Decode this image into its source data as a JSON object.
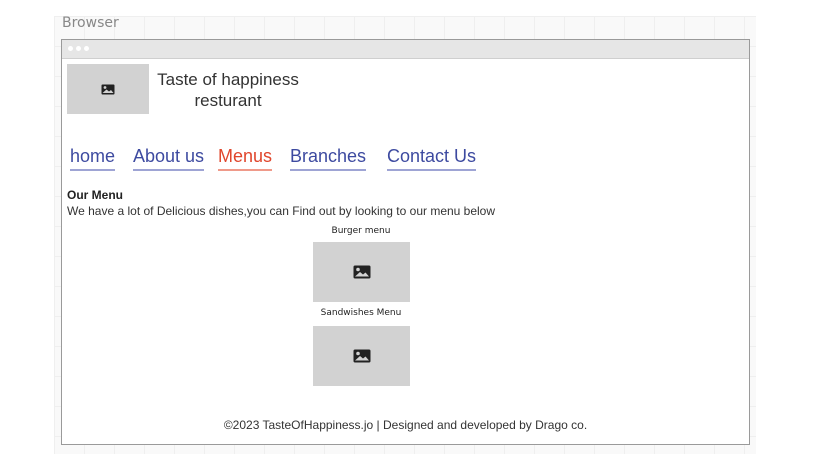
{
  "canvas_label": "Browser",
  "site": {
    "logo_icon": "image-icon",
    "title_line1": "Taste of happiness",
    "title_line2": "resturant"
  },
  "nav": [
    {
      "label": "home",
      "active": false
    },
    {
      "label": "About us",
      "active": false
    },
    {
      "label": "Menus",
      "active": true
    },
    {
      "label": "Branches",
      "active": false
    },
    {
      "label": "Contact Us",
      "active": false
    }
  ],
  "section": {
    "title": "Our Menu",
    "description": "We have a lot of Delicious dishes,you can Find out by looking to our menu below"
  },
  "menus": [
    {
      "caption": "Burger menu",
      "icon": "image-icon"
    },
    {
      "caption": "Sandwishes Menu",
      "icon": "image-icon"
    }
  ],
  "footer": {
    "text": "©2023 TasteOfHappiness.jo | Designed and developed by Drago co."
  },
  "colors": {
    "nav_link": "#3d4aa0",
    "nav_active": "#e0462c",
    "placeholder": "#d2d2d2"
  }
}
